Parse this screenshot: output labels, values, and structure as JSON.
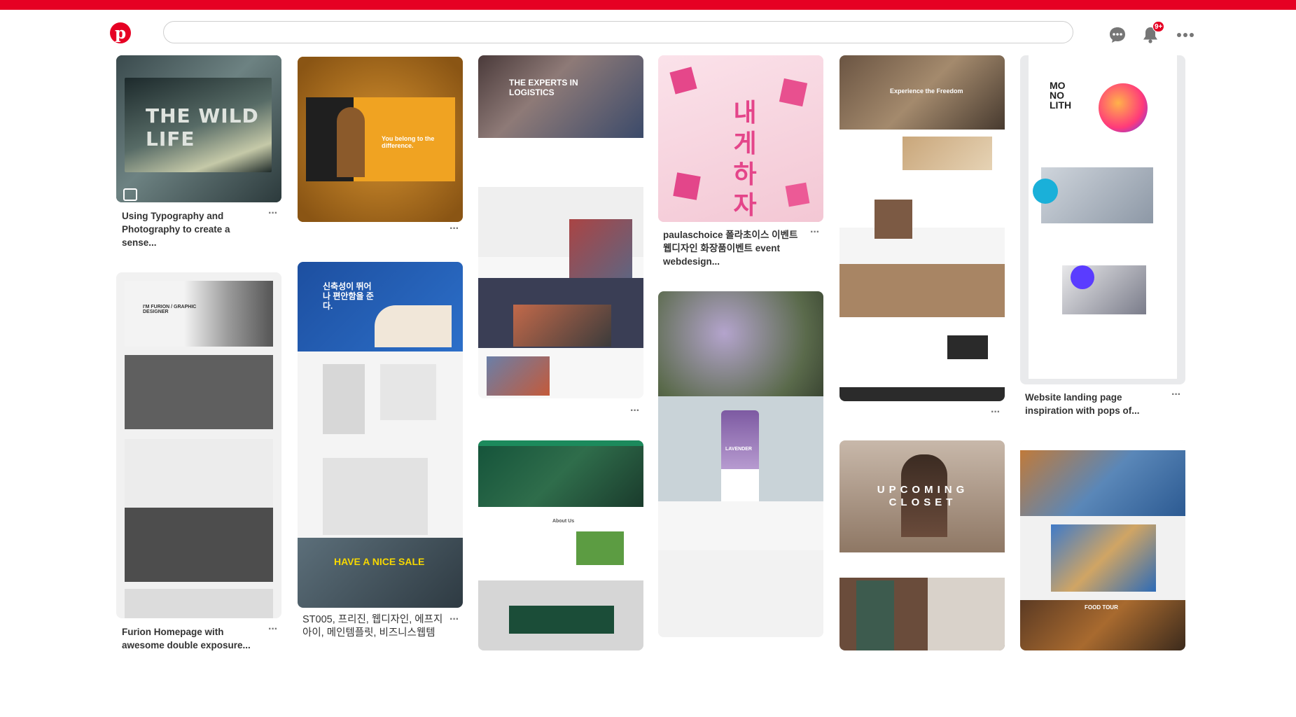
{
  "header": {
    "logo_letter": "p",
    "search_placeholder": "",
    "notification_count": "9+",
    "brand_color": "#e60023"
  },
  "icons": {
    "messages": "chat-bubble-icon",
    "notifications": "bell-icon",
    "more": "more-dots-icon"
  },
  "pins": [
    {
      "caption": "Using Typography and Photography to create a sense...",
      "art_text": "THE WILD LIFE"
    },
    {
      "caption": "",
      "art_text": "You belong to the difference."
    },
    {
      "caption": "",
      "art_text": "THE EXPERTS IN LOGISTICS"
    },
    {
      "caption": "paulaschoice 폴라초이스 이벤트 웹디자인 화장품이벤트 event webdesign...",
      "art_text": "내게하자"
    },
    {
      "caption": "",
      "art_text": "Experience the Freedom"
    },
    {
      "caption": "Website landing page inspiration with pops of...",
      "art_text": "MO NO LITH"
    },
    {
      "caption": "Furion Homepage with awesome double exposure...",
      "art_text": "I'M FURION / GRAPHIC DESIGNER"
    },
    {
      "caption": "ST005, 프리진, 웹디자인, 에프지아이, 메인템플릿, 비즈니스웹템",
      "art_text": "신축성이 뛰어나 편안함을 준다."
    },
    {
      "caption": "",
      "art_text": "About Us"
    },
    {
      "caption": "",
      "art_text": "LAVENDER"
    },
    {
      "caption": "",
      "art_text": "UPCOMING CLOSET"
    },
    {
      "caption": "",
      "art_text": "FOOD TOUR"
    }
  ],
  "more_label": "···"
}
